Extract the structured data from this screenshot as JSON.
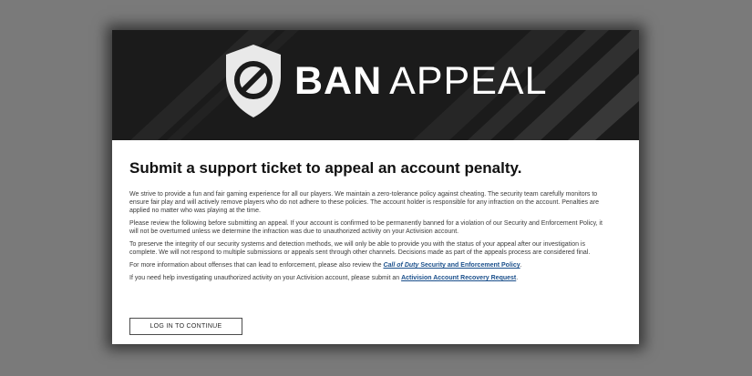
{
  "banner": {
    "logo_icon": "shield-ban-icon",
    "title_bold": "BAN",
    "title_light": "APPEAL"
  },
  "main": {
    "heading": "Submit a support ticket to appeal an account penalty.",
    "paragraphs": [
      "We strive to provide a fun and fair gaming experience for all our players. We maintain a zero-tolerance policy against cheating. The security team carefully monitors to ensure fair play and will actively remove players who do not adhere to these policies. The account holder is responsible for any infraction on the account. Penalties are applied no matter who was playing at the time.",
      "Please review the following before submitting an appeal. If your account is confirmed to be permanently banned for a violation of our Security and Enforcement Policy, it will not be overturned unless we determine the infraction was due to unauthorized activity on your Activision account.",
      "To preserve the integrity of our security systems and detection methods, we will only be able to provide you with the status of your appeal after our investigation is complete. We will not respond to multiple submissions or appeals sent through other channels. Decisions made as part of the appeals process are considered final."
    ],
    "policy_line": {
      "prefix": "For more information about offenses that can lead to enforcement, please also review the ",
      "link_game": "Call of Duty",
      "link_rest": " Security and Enforcement Policy",
      "suffix": "."
    },
    "recovery_line": {
      "prefix": "If you need help investigating unauthorized activity on your Activision account, please submit an ",
      "link": "Activision Account Recovery Request",
      "suffix": "."
    },
    "login_button": "LOG IN TO CONTINUE"
  },
  "colors": {
    "page_bg": "#7a7a7a",
    "banner_bg": "#1b1b1b",
    "link": "#1a4f8b"
  }
}
